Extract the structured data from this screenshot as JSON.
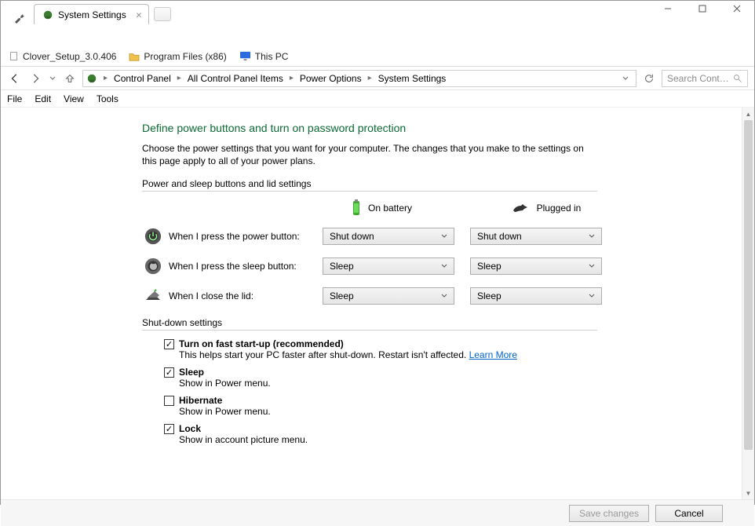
{
  "window": {
    "tab_title": "System Settings"
  },
  "bookmarks": [
    {
      "label": "Clover_Setup_3.0.406",
      "icon": "file"
    },
    {
      "label": "Program Files (x86)",
      "icon": "folder"
    },
    {
      "label": "This PC",
      "icon": "monitor"
    }
  ],
  "breadcrumbs": [
    "Control Panel",
    "All Control Panel Items",
    "Power Options",
    "System Settings"
  ],
  "search_placeholder": "Search Contr...",
  "menu": [
    "File",
    "Edit",
    "View",
    "Tools"
  ],
  "page": {
    "heading": "Define power buttons and turn on password protection",
    "description": "Choose the power settings that you want for your computer. The changes that you make to the settings on this page apply to all of your power plans.",
    "section1_title": "Power and sleep buttons and lid settings",
    "columns": {
      "battery": "On battery",
      "plugged": "Plugged in"
    },
    "rows": [
      {
        "label": "When I press the power button:",
        "battery": "Shut down",
        "plugged": "Shut down",
        "icon": "power"
      },
      {
        "label": "When I press the sleep button:",
        "battery": "Sleep",
        "plugged": "Sleep",
        "icon": "sleep"
      },
      {
        "label": "When I close the lid:",
        "battery": "Sleep",
        "plugged": "Sleep",
        "icon": "lid"
      }
    ],
    "section2_title": "Shut-down settings",
    "shutdown": [
      {
        "checked": true,
        "label": "Turn on fast start-up (recommended)",
        "desc": "This helps start your PC faster after shut-down. Restart isn't affected.",
        "learn_more": "Learn More"
      },
      {
        "checked": true,
        "label": "Sleep",
        "desc": "Show in Power menu."
      },
      {
        "checked": false,
        "label": "Hibernate",
        "desc": "Show in Power menu."
      },
      {
        "checked": true,
        "label": "Lock",
        "desc": "Show in account picture menu."
      }
    ]
  },
  "footer": {
    "save": "Save changes",
    "cancel": "Cancel"
  }
}
